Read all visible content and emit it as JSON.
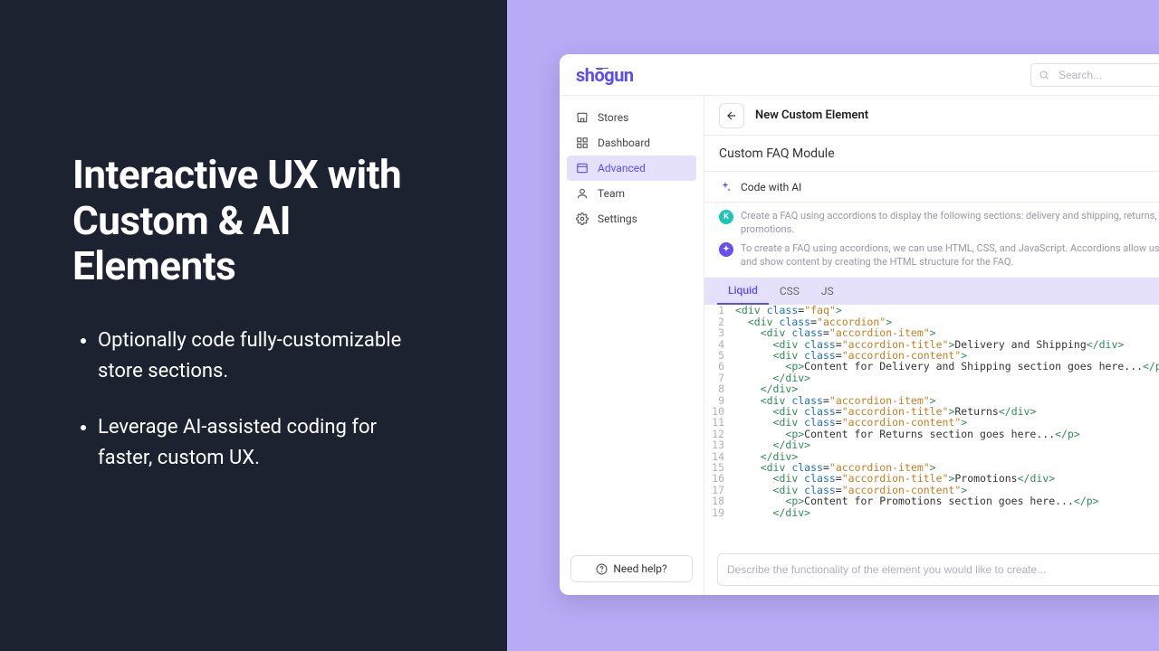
{
  "marketing": {
    "heading": "Interactive UX with Custom & AI Elements",
    "bullet1": "Optionally code fully-customizable store sections.",
    "bullet2": "Leverage AI-assisted coding for faster, custom UX."
  },
  "app": {
    "logo": "shōgun",
    "search_placeholder": "Search...",
    "nav": {
      "stores": "Stores",
      "dashboard": "Dashboard",
      "advanced": "Advanced",
      "team": "Team",
      "settings": "Settings"
    },
    "help": "Need help?",
    "page_title": "New Custom Element",
    "element_name": "Custom FAQ Module",
    "code_with_ai": "Code with AI",
    "chat": {
      "user_initial": "K",
      "user_msg": "Create a FAQ using accordions to display the following sections: delivery and shipping, returns, promotions.",
      "ai_msg": "To create a FAQ using accordions, we can use HTML, CSS, and JavaScript. Accordions allow us to hide and show content by creating the HTML structure for the FAQ."
    },
    "tabs": {
      "liquid": "Liquid",
      "css": "CSS",
      "js": "JS"
    },
    "prompt_placeholder": "Describe the functionality of the element you would like to create...",
    "code_lines": [
      [
        [
          "t-green",
          "<div "
        ],
        [
          "t-blue",
          "class"
        ],
        [
          "t-black",
          "="
        ],
        [
          "t-orange",
          "\"faq\""
        ],
        [
          "t-green",
          ">"
        ]
      ],
      [
        [
          "t-black",
          "  "
        ],
        [
          "t-green",
          "<div "
        ],
        [
          "t-blue",
          "class"
        ],
        [
          "t-black",
          "="
        ],
        [
          "t-orange",
          "\"accordion\""
        ],
        [
          "t-green",
          ">"
        ]
      ],
      [
        [
          "t-black",
          "    "
        ],
        [
          "t-green",
          "<div "
        ],
        [
          "t-blue",
          "class"
        ],
        [
          "t-black",
          "="
        ],
        [
          "t-orange",
          "\"accordion-item\""
        ],
        [
          "t-green",
          ">"
        ]
      ],
      [
        [
          "t-black",
          "      "
        ],
        [
          "t-green",
          "<div "
        ],
        [
          "t-blue",
          "class"
        ],
        [
          "t-black",
          "="
        ],
        [
          "t-orange",
          "\"accordion-title\""
        ],
        [
          "t-green",
          ">"
        ],
        [
          "t-black",
          "Delivery and Shipping"
        ],
        [
          "t-green",
          "</div>"
        ]
      ],
      [
        [
          "t-black",
          "      "
        ],
        [
          "t-green",
          "<div "
        ],
        [
          "t-blue",
          "class"
        ],
        [
          "t-black",
          "="
        ],
        [
          "t-orange",
          "\"accordion-content\""
        ],
        [
          "t-green",
          ">"
        ]
      ],
      [
        [
          "t-black",
          "        "
        ],
        [
          "t-green",
          "<p>"
        ],
        [
          "t-black",
          "Content for Delivery and Shipping section goes here..."
        ],
        [
          "t-green",
          "</p>"
        ]
      ],
      [
        [
          "t-black",
          "      "
        ],
        [
          "t-green",
          "</div>"
        ]
      ],
      [
        [
          "t-black",
          "    "
        ],
        [
          "t-green",
          "</div>"
        ]
      ],
      [
        [
          "t-black",
          "    "
        ],
        [
          "t-green",
          "<div "
        ],
        [
          "t-blue",
          "class"
        ],
        [
          "t-black",
          "="
        ],
        [
          "t-orange",
          "\"accordion-item\""
        ],
        [
          "t-green",
          ">"
        ]
      ],
      [
        [
          "t-black",
          "      "
        ],
        [
          "t-green",
          "<div "
        ],
        [
          "t-blue",
          "class"
        ],
        [
          "t-black",
          "="
        ],
        [
          "t-orange",
          "\"accordion-title\""
        ],
        [
          "t-green",
          ">"
        ],
        [
          "t-black",
          "Returns"
        ],
        [
          "t-green",
          "</div>"
        ]
      ],
      [
        [
          "t-black",
          "      "
        ],
        [
          "t-green",
          "<div "
        ],
        [
          "t-blue",
          "class"
        ],
        [
          "t-black",
          "="
        ],
        [
          "t-orange",
          "\"accordion-content\""
        ],
        [
          "t-green",
          ">"
        ]
      ],
      [
        [
          "t-black",
          "        "
        ],
        [
          "t-green",
          "<p>"
        ],
        [
          "t-black",
          "Content for Returns section goes here..."
        ],
        [
          "t-green",
          "</p>"
        ]
      ],
      [
        [
          "t-black",
          "      "
        ],
        [
          "t-green",
          "</div>"
        ]
      ],
      [
        [
          "t-black",
          "    "
        ],
        [
          "t-green",
          "</div>"
        ]
      ],
      [
        [
          "t-black",
          "    "
        ],
        [
          "t-green",
          "<div "
        ],
        [
          "t-blue",
          "class"
        ],
        [
          "t-black",
          "="
        ],
        [
          "t-orange",
          "\"accordion-item\""
        ],
        [
          "t-green",
          ">"
        ]
      ],
      [
        [
          "t-black",
          "      "
        ],
        [
          "t-green",
          "<div "
        ],
        [
          "t-blue",
          "class"
        ],
        [
          "t-black",
          "="
        ],
        [
          "t-orange",
          "\"accordion-title\""
        ],
        [
          "t-green",
          ">"
        ],
        [
          "t-black",
          "Promotions"
        ],
        [
          "t-green",
          "</div>"
        ]
      ],
      [
        [
          "t-black",
          "      "
        ],
        [
          "t-green",
          "<div "
        ],
        [
          "t-blue",
          "class"
        ],
        [
          "t-black",
          "="
        ],
        [
          "t-orange",
          "\"accordion-content\""
        ],
        [
          "t-green",
          ">"
        ]
      ],
      [
        [
          "t-black",
          "        "
        ],
        [
          "t-green",
          "<p>"
        ],
        [
          "t-black",
          "Content for Promotions section goes here..."
        ],
        [
          "t-green",
          "</p>"
        ]
      ],
      [
        [
          "t-black",
          "      "
        ],
        [
          "t-green",
          "</div>"
        ]
      ]
    ]
  }
}
